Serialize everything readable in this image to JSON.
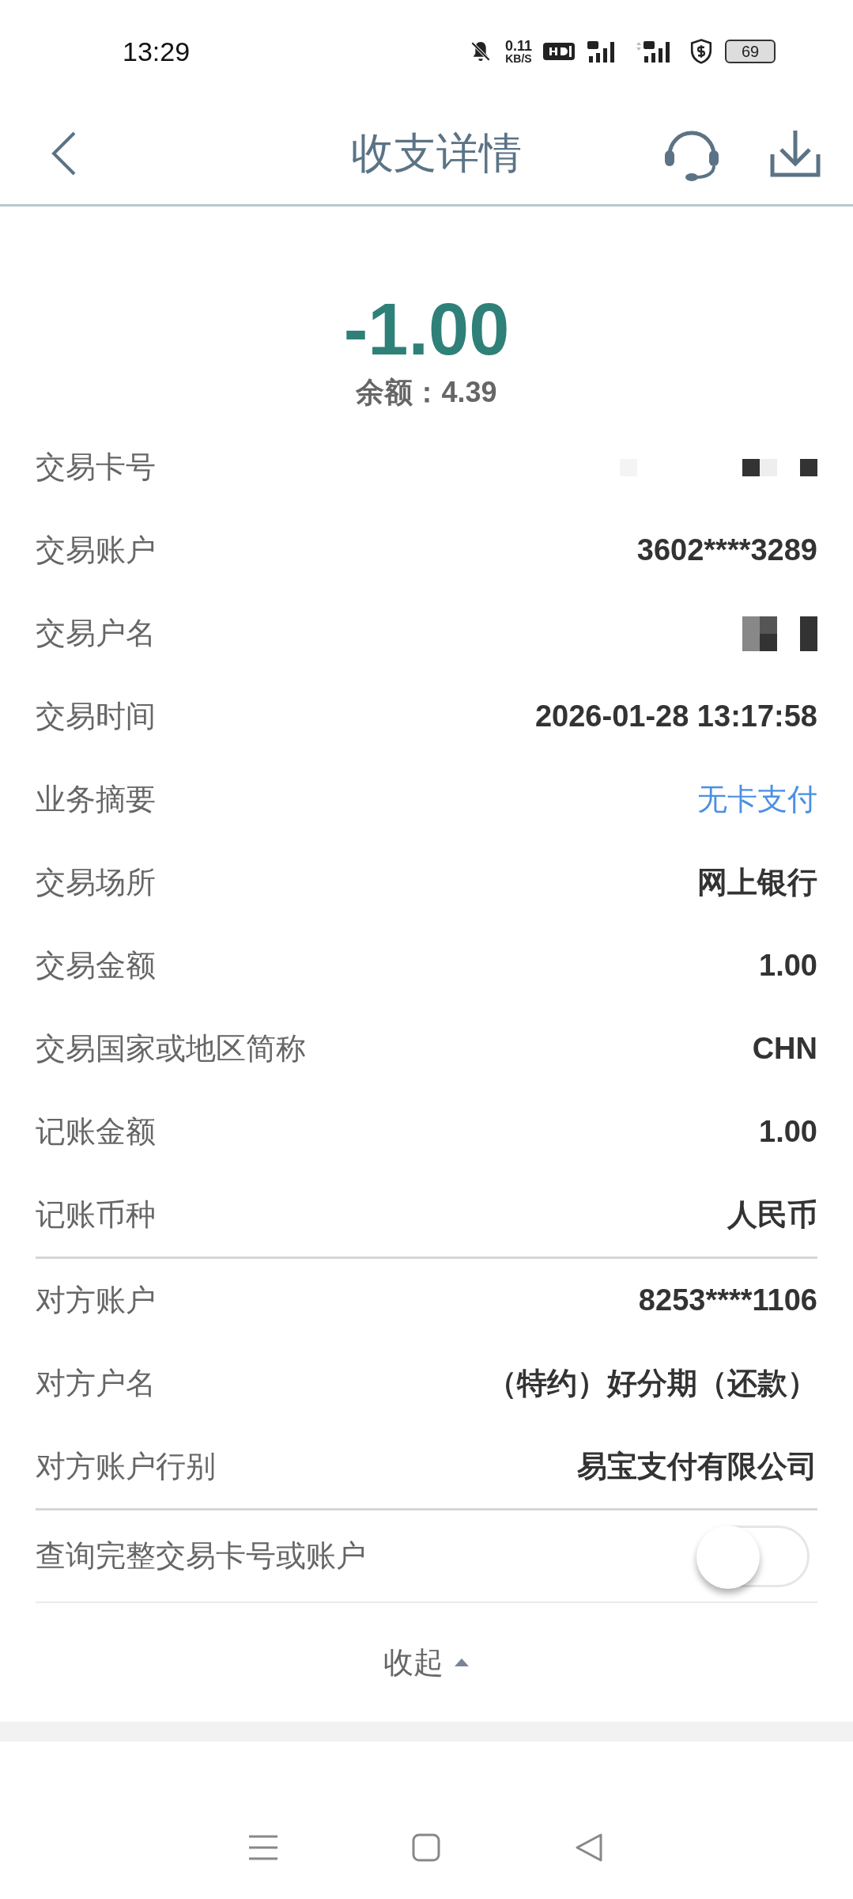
{
  "status_bar": {
    "time": "13:29",
    "net_speed_value": "0.11",
    "net_speed_unit": "KB/S",
    "battery": "69"
  },
  "header": {
    "title": "收支详情"
  },
  "amount": "-1.00",
  "balance": {
    "label": "余额：",
    "value": "4.39"
  },
  "detail_groups": [
    [
      {
        "label": "交易卡号",
        "kind": "redacted"
      },
      {
        "label": "交易账户",
        "value": "3602****3289",
        "kind": "text"
      },
      {
        "label": "交易户名",
        "kind": "redacted"
      },
      {
        "label": "交易时间",
        "value": "2026-01-28 13:17:58",
        "kind": "text"
      },
      {
        "label": "业务摘要",
        "value": "无卡支付",
        "kind": "link"
      },
      {
        "label": "交易场所",
        "value": "网上银行",
        "kind": "text"
      },
      {
        "label": "交易金额",
        "value": "1.00",
        "kind": "text"
      },
      {
        "label": "交易国家或地区简称",
        "value": "CHN",
        "kind": "text"
      },
      {
        "label": "记账金额",
        "value": "1.00",
        "kind": "text"
      },
      {
        "label": "记账币种",
        "value": "人民币",
        "kind": "text"
      }
    ],
    [
      {
        "label": "对方账户",
        "value": "8253****1106",
        "kind": "text"
      },
      {
        "label": "对方户名",
        "value": "（特约）好分期（还款）",
        "kind": "text"
      },
      {
        "label": "对方账户行别",
        "value": "易宝支付有限公司",
        "kind": "text"
      }
    ]
  ],
  "full_number_toggle": {
    "label": "查询完整交易卡号或账户",
    "on": false
  },
  "collapse": {
    "label": "收起",
    "expanded": true
  }
}
